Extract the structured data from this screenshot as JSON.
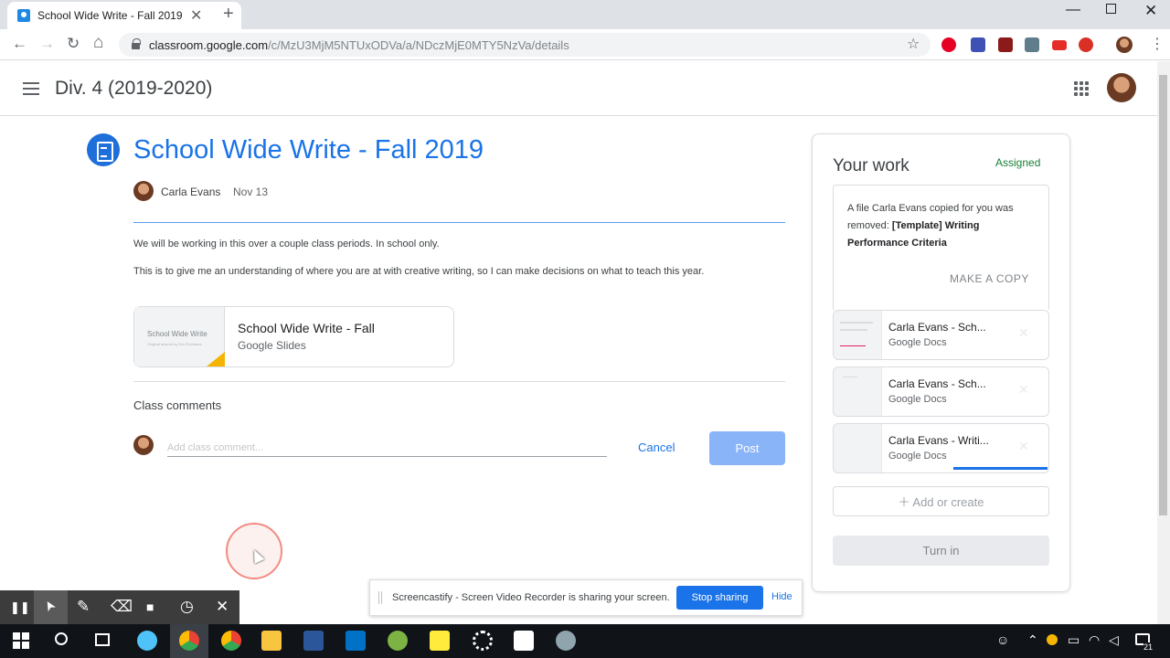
{
  "browser": {
    "tab_title": "School Wide Write - Fall 2019",
    "tab_close": "✕",
    "new_tab": "+",
    "url_host": "classroom.google.com",
    "url_path": "/c/MzU3MjM5NTUxODVa/a/NDczMjE0MTY5NzVa/details",
    "back": "←",
    "forward": "→",
    "reload": "↻",
    "home": "⌂",
    "star": "☆",
    "menu": "⋮",
    "win_min": "—",
    "win_close": "✕"
  },
  "header": {
    "class_title": "Div. 4 (2019-2020)"
  },
  "assignment": {
    "title": "School Wide Write - Fall 2019",
    "author": "Carla Evans",
    "date": "Nov 13",
    "description": [
      "We will be working in this over a couple class periods. In school only.",
      "This is to give me an understanding of where you are at with creative writing, so I can make decisions on what to teach this year."
    ],
    "attachment": {
      "thumb_text": "School Wide Write",
      "thumb_sub": "Original artwork by Eric Rohmann",
      "title": "School Wide Write - Fall",
      "type": "Google Slides"
    },
    "comments": {
      "label": "Class comments",
      "placeholder": "Add class comment...",
      "cancel": "Cancel",
      "post": "Post"
    }
  },
  "your_work": {
    "title": "Your work",
    "status": "Assigned",
    "removed_msg_prefix": "A file Carla Evans copied for you was removed: ",
    "removed_msg_file": "[Template] Writing Performance Criteria",
    "make_copy": "MAKE A COPY",
    "files": [
      {
        "name": "Carla Evans - Sch...",
        "type": "Google Docs"
      },
      {
        "name": "Carla Evans - Sch...",
        "type": "Google Docs"
      },
      {
        "name": "Carla Evans - Writi...",
        "type": "Google Docs"
      }
    ],
    "file_remove": "✕",
    "add_create": "＋  Add or create",
    "turn_in": "Turn in"
  },
  "screencastify": {
    "tools": [
      "❚❚",
      "➤",
      "✎",
      "⌫",
      "■",
      "◷",
      "✕"
    ]
  },
  "share_bar": {
    "message": "Screencastify - Screen Video Recorder is sharing your screen.",
    "stop": "Stop sharing",
    "hide": "Hide"
  },
  "taskbar": {
    "notification_count": "21"
  },
  "colors": {
    "classroom_blue": "#1a73e8",
    "assigned_green": "#188038",
    "attachment_accent": "#f4b400"
  }
}
